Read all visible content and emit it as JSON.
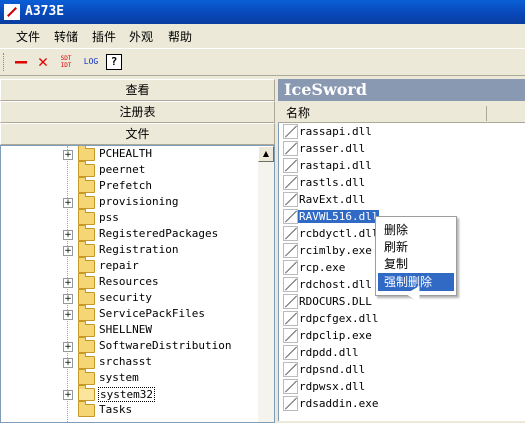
{
  "window": {
    "title": "A373E"
  },
  "menu": [
    "文件",
    "转储",
    "插件",
    "外观",
    "帮助"
  ],
  "toolbar": {
    "sdt_label": "SDT\nIDT",
    "log_label": "LOG",
    "help_label": "?"
  },
  "left_panel": {
    "buttons": [
      "查看",
      "注册表",
      "文件"
    ],
    "tree": [
      {
        "label": "PCHEALTH",
        "expandable": true
      },
      {
        "label": "peernet",
        "expandable": false
      },
      {
        "label": "Prefetch",
        "expandable": false
      },
      {
        "label": "provisioning",
        "expandable": true
      },
      {
        "label": "pss",
        "expandable": false
      },
      {
        "label": "RegisteredPackages",
        "expandable": true
      },
      {
        "label": "Registration",
        "expandable": true
      },
      {
        "label": "repair",
        "expandable": false
      },
      {
        "label": "Resources",
        "expandable": true
      },
      {
        "label": "security",
        "expandable": true
      },
      {
        "label": "ServicePackFiles",
        "expandable": true
      },
      {
        "label": "SHELLNEW",
        "expandable": false
      },
      {
        "label": "SoftwareDistribution",
        "expandable": true
      },
      {
        "label": "srchasst",
        "expandable": true
      },
      {
        "label": "system",
        "expandable": false
      },
      {
        "label": "system32",
        "expandable": true,
        "selected": true
      },
      {
        "label": "Tasks",
        "expandable": false
      }
    ]
  },
  "right_panel": {
    "header": "IceSword",
    "column": "名称",
    "files": [
      {
        "name": "rassapi.dll"
      },
      {
        "name": "rasser.dll"
      },
      {
        "name": "rastapi.dll"
      },
      {
        "name": "rastls.dll"
      },
      {
        "name": "RavExt.dll"
      },
      {
        "name": "RAVWL516.dll",
        "selected": true
      },
      {
        "name": "rcbdyctl.dll"
      },
      {
        "name": "rcimlby.exe"
      },
      {
        "name": "rcp.exe"
      },
      {
        "name": "rdchost.dll"
      },
      {
        "name": "RDOCURS.DLL"
      },
      {
        "name": "rdpcfgex.dll"
      },
      {
        "name": "rdpclip.exe"
      },
      {
        "name": "rdpdd.dll"
      },
      {
        "name": "rdpsnd.dll"
      },
      {
        "name": "rdpwsx.dll"
      },
      {
        "name": "rdsaddin.exe"
      }
    ]
  },
  "context_menu": {
    "items": [
      "删除",
      "刷新",
      "复制",
      "强制删除"
    ],
    "highlighted": "强制删除"
  }
}
